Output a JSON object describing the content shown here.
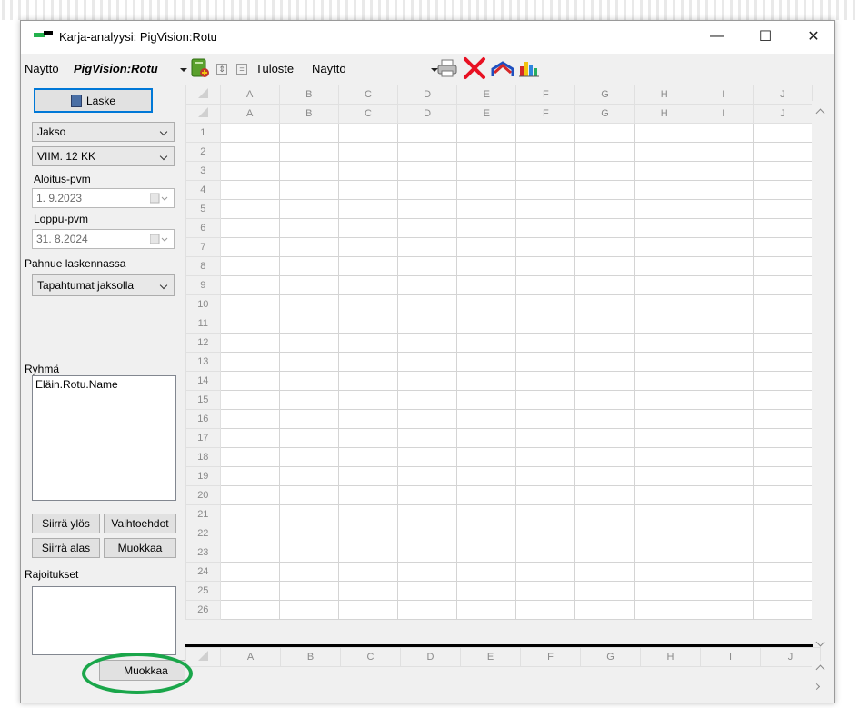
{
  "window": {
    "title": "Karja-analyysi: PigVision:Rotu",
    "controls": {
      "minimize": "—",
      "maximize": "☐",
      "close": "✕"
    }
  },
  "toolbar": {
    "view_label": "Näyttö",
    "view_value": "PigVision:Rotu",
    "output_label": "Tuloste",
    "output_value": "Näyttö"
  },
  "left": {
    "calculate_button": "Laske",
    "period_combo": "Jakso",
    "period_value_combo": "VIIM. 12 KK",
    "start_date_label": "Aloitus-pvm",
    "start_date_value": "1. 9.2023",
    "end_date_label": "Loppu-pvm",
    "end_date_value": "31. 8.2024",
    "litter_label": "Pahnue laskennassa",
    "litter_value": "Tapahtumat jaksolla",
    "group_label": "Ryhmä",
    "group_items": [
      "Eläin.Rotu.Name"
    ],
    "move_up_button": "Siirrä ylös",
    "options_button": "Vaihtoehdot",
    "move_down_button": "Siirrä alas",
    "edit_button": "Muokkaa",
    "restrictions_label": "Rajoitukset",
    "edit_restrictions_button": "Muokkaa"
  },
  "sheet": {
    "columns": [
      "A",
      "B",
      "C",
      "D",
      "E",
      "F",
      "G",
      "H",
      "I",
      "J"
    ],
    "rows": [
      "1",
      "2",
      "3",
      "4",
      "5",
      "6",
      "7",
      "8",
      "9",
      "10",
      "11",
      "12",
      "13",
      "14",
      "15",
      "16",
      "17",
      "18",
      "19",
      "20",
      "21",
      "22",
      "23",
      "24",
      "25",
      "26"
    ]
  },
  "colors": {
    "accent_border": "#0078d7",
    "highlight_oval": "#1aa64a",
    "delete_x": "#e81123"
  },
  "icons": [
    "app-logo-icon",
    "run-report-icon",
    "expand-icon",
    "collapse-icon",
    "printer-icon",
    "delete-icon",
    "line-chart-icon",
    "bar-chart-icon",
    "calculator-icon",
    "calendar-icon"
  ]
}
